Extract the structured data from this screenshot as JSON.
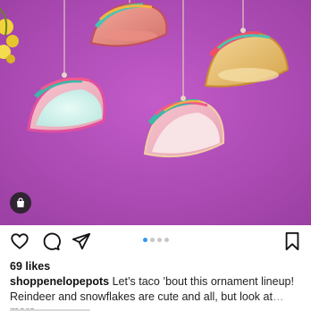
{
  "post": {
    "image_alt": "Taco ornaments hanging on a purple background",
    "carousel": {
      "count": 4,
      "active": 0
    },
    "actions": {
      "like_icon": "heart-icon",
      "comment_icon": "comment-icon",
      "share_icon": "paper-plane-icon",
      "save_icon": "bookmark-icon"
    },
    "likes_text": "69 likes",
    "caption": {
      "username": "shoppenelopepots",
      "text": " Let’s taco ’bout this ornament lineup! Reindeer and snowflakes are cute and all, but look at",
      "more": "… more"
    }
  },
  "colors": {
    "background": "#b04fb6",
    "carousel_active": "#3897f0",
    "text_muted": "#8e8e8e"
  }
}
